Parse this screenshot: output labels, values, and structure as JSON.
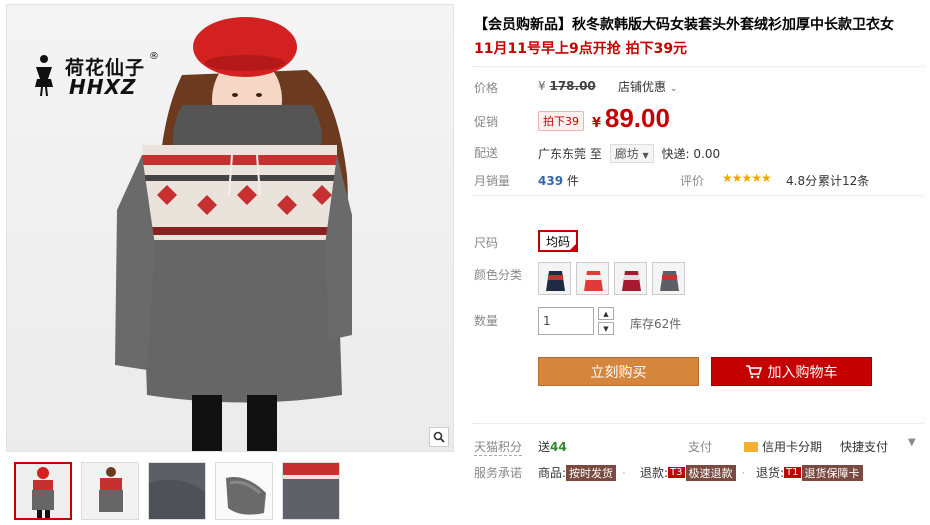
{
  "brand": {
    "name_cn": "荷花仙子",
    "name_en": "HHXZ",
    "reg": "®"
  },
  "product": {
    "title": "【会员购新品】秋冬款韩版大码女装套头外套绒衫加厚中长款卫衣女",
    "subtitle": "11月11号早上9点开抢 拍下39元"
  },
  "pricing": {
    "label_price": "价格",
    "currency": "¥",
    "original": "178.00",
    "shop_promo": "店铺优惠",
    "label_promo": "促销",
    "promo_tag": "拍下39",
    "promo_price": "89.00",
    "label_ship": "配送",
    "ship_from": "广东东莞",
    "ship_to_word": "至",
    "ship_to_city": "廊坊",
    "ship_fee": "快递: 0.00",
    "label_sales": "月销量",
    "sales_count": "439",
    "sales_unit": "件",
    "label_rating": "评价",
    "stars": "★★★★★",
    "rating_value": 4.8,
    "rating_score": "4.8分",
    "review_count": "累计12条"
  },
  "options": {
    "label_size": "尺码",
    "size_selected": "均码",
    "label_color": "颜色分类",
    "colors": [
      "navy",
      "red",
      "crimson",
      "grey"
    ],
    "label_qty": "数量",
    "qty_value": "1",
    "stock": "库存62件"
  },
  "actions": {
    "buy": "立刻购买",
    "cart": "加入购物车"
  },
  "extras": {
    "label_points": "天猫积分",
    "points_text": "送",
    "points_value": "44",
    "label_pay": "支付",
    "card_pay": "信用卡分期",
    "quick_pay": "快捷支付",
    "label_service": "服务承诺",
    "svc1_key": "商品:",
    "svc1_tag": "按时发货",
    "svc2_key": "退款:",
    "svc2_badge": "T3",
    "svc2_tag": "极速退款",
    "svc3_key": "退货:",
    "svc3_badge": "T1",
    "svc3_tag": "退货保障卡"
  },
  "colors_theme": {
    "accent": "#c40000",
    "buy": "#d6863c",
    "star": "#f0a800"
  }
}
